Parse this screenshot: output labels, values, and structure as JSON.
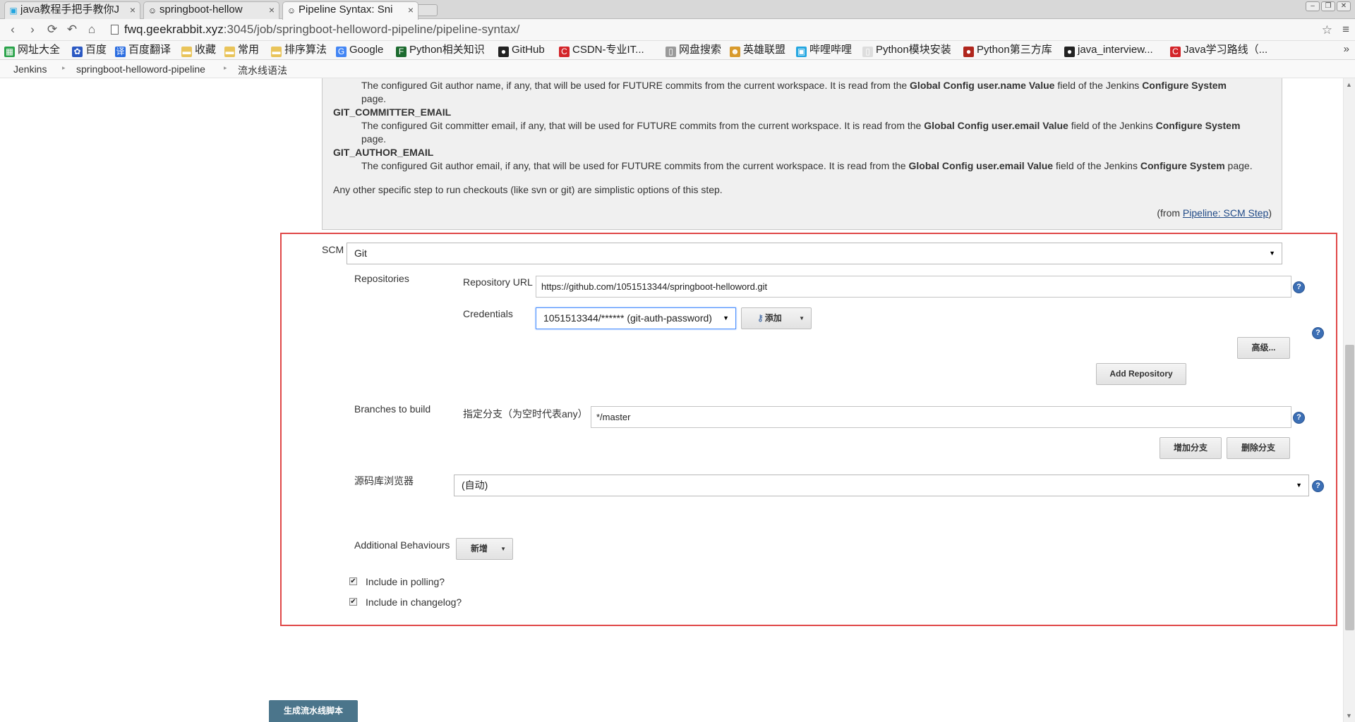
{
  "browser": {
    "tabs": [
      {
        "title": "java教程手把手教你J",
        "icon": "bilibili-icon"
      },
      {
        "title": "springboot-hellow",
        "icon": "jenkins-icon"
      },
      {
        "title": "Pipeline Syntax: Sni",
        "icon": "jenkins-icon",
        "active": true
      }
    ],
    "address": {
      "host": "fwq.geekrabbit.xyz",
      "path": ":3045/job/springboot-helloword-pipeline/pipeline-syntax/"
    },
    "bookmarks": [
      {
        "label": "网址大全",
        "icon": "grid-icon",
        "color": "#2aa34a"
      },
      {
        "label": "百度",
        "icon": "paw-icon",
        "color": "#2b59c3"
      },
      {
        "label": "百度翻译",
        "icon": "translate-icon",
        "color": "#2b6de0"
      },
      {
        "label": "收藏",
        "icon": "folder-icon",
        "color": "#e9c45a"
      },
      {
        "label": "常用",
        "icon": "folder-icon",
        "color": "#e9c45a"
      },
      {
        "label": "排序算法",
        "icon": "folder-icon",
        "color": "#e9c45a"
      },
      {
        "label": "Google",
        "icon": "google-icon",
        "color": "#4285f4"
      },
      {
        "label": "Python相关知识",
        "icon": "fc-icon",
        "color": "#1c6b2f"
      },
      {
        "label": "GitHub",
        "icon": "github-icon",
        "color": "#222222"
      },
      {
        "label": "CSDN-专业IT...",
        "icon": "csdn-icon",
        "color": "#d3252a"
      },
      {
        "label": "网盘搜索",
        "icon": "page-icon",
        "color": "#9a9a9a"
      },
      {
        "label": "英雄联盟",
        "icon": "lol-icon",
        "color": "#d89a2c"
      },
      {
        "label": "哔哩哔哩",
        "icon": "bilibili-icon",
        "color": "#23a6e0"
      },
      {
        "label": "Python模块安装",
        "icon": "blank-page-icon",
        "color": "#dddddd"
      },
      {
        "label": "Python第三方库",
        "icon": "python-icon",
        "color": "#b0261d"
      },
      {
        "label": "java_interview...",
        "icon": "github-icon",
        "color": "#222222"
      },
      {
        "label": "Java学习路线（...",
        "icon": "csdn-icon",
        "color": "#d3252a"
      }
    ]
  },
  "breadcrumbs": [
    "Jenkins",
    "springboot-helloword-pipeline",
    "流水线语法"
  ],
  "help": {
    "top_line": {
      "pre": "The configured Git author name, if any, that will be used for FUTURE commits from the current workspace. It is read from the ",
      "b1": "Global Config user.name Value",
      "mid": " field of the Jenkins ",
      "b2": "Configure System",
      "post": ""
    },
    "top_line_cont": "page.",
    "committer_var": "GIT_COMMITTER_EMAIL",
    "committer": {
      "pre": "The configured Git committer email, if any, that will be used for FUTURE commits from the current workspace. It is read from the ",
      "b1": "Global Config user.email Value",
      "mid": " field of the Jenkins ",
      "b2": "Configure System"
    },
    "committer_cont": "page.",
    "author_var": "GIT_AUTHOR_EMAIL",
    "author": {
      "pre": "The configured Git author email, if any, that will be used for FUTURE commits from the current workspace. It is read from the ",
      "b1": "Global Config user.email Value",
      "mid": " field of the Jenkins ",
      "b2": "Configure System",
      "post": " page."
    },
    "other": "Any other specific step to run checkouts (like svn or git) are simplistic options of this step.",
    "from_pre": "(from ",
    "from_link": "Pipeline: SCM Step",
    "from_post": ")"
  },
  "form": {
    "scm_label": "SCM",
    "scm_value": "Git",
    "repositories_label": "Repositories",
    "repo_url_label": "Repository URL",
    "repo_url_value": "https://github.com/1051513344/springboot-helloword.git",
    "credentials_label": "Credentials",
    "credentials_value": "1051513344/****** (git-auth-password)",
    "add_button": "添加",
    "advanced_button": "高级...",
    "add_repository_button": "Add Repository",
    "branches_label": "Branches to build",
    "branch_spec_label": "指定分支（为空时代表any）",
    "branch_spec_value": "*/master",
    "add_branch_button": "增加分支",
    "delete_branch_button": "删除分支",
    "repo_browser_label": "源码库浏览器",
    "repo_browser_value": "(自动)",
    "additional_label": "Additional Behaviours",
    "additional_button": "新增",
    "include_polling": {
      "label": "Include in polling?",
      "checked": true
    },
    "include_changelog": {
      "label": "Include in changelog?",
      "checked": true
    }
  },
  "generate_button": "生成流水线脚本",
  "colors": {
    "highlight_border": "#e04848",
    "help_icon": "#3c6fb5",
    "primary_button": "#4b758b"
  }
}
